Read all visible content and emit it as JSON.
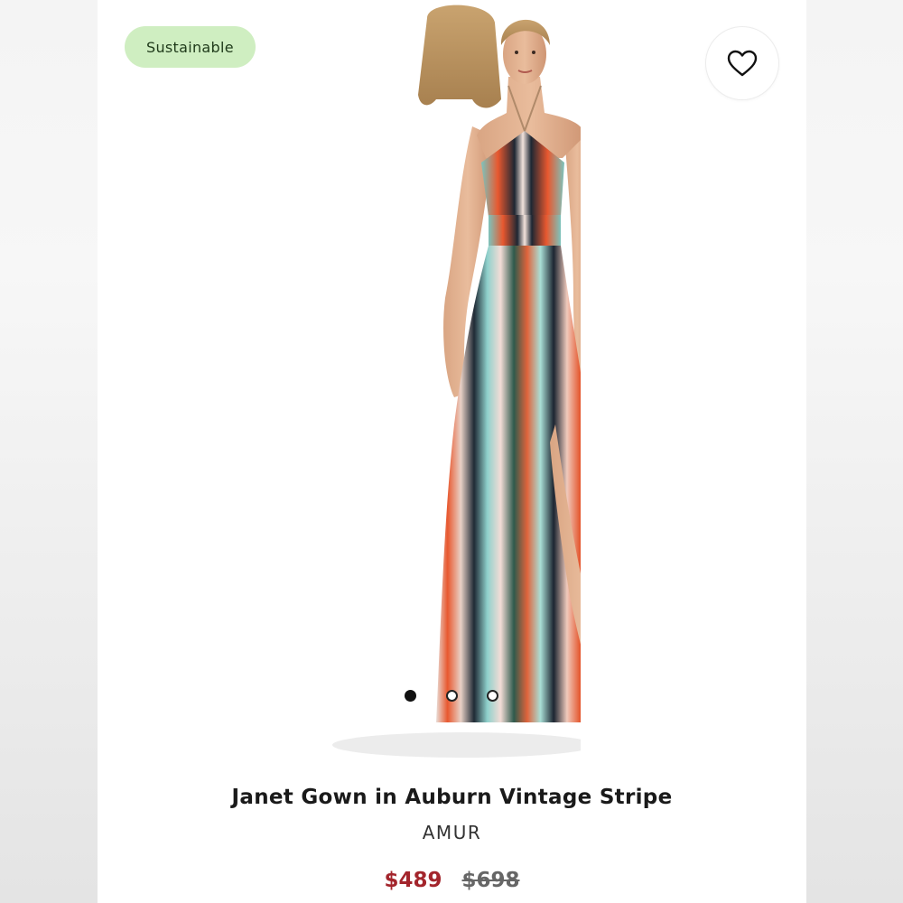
{
  "badge": {
    "label": "Sustainable",
    "color": "#cfeec1"
  },
  "wishlist": {
    "icon": "heart-outline-icon"
  },
  "product": {
    "image": "model-in-striped-halter-gown",
    "title": "Janet Gown in Auburn Vintage Stripe",
    "brand": "AMUR",
    "sale_price": "$489",
    "original_price": "$698",
    "sale_color": "#a3252c"
  },
  "carousel": {
    "total": 3,
    "active": 1
  }
}
